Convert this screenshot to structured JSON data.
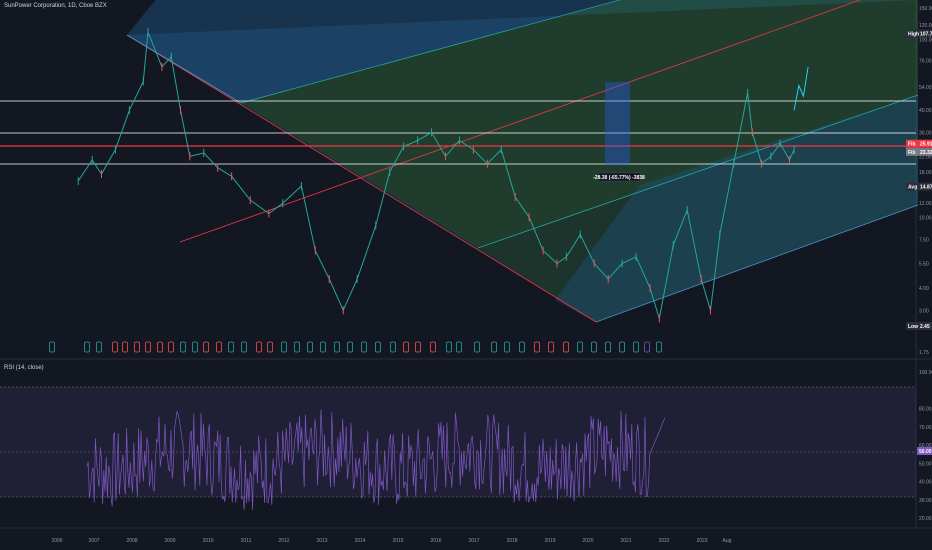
{
  "header": {
    "title": "SunPower Corporation, 1D, Cboe BZX",
    "rsi_title": "RSI (14, close)"
  },
  "colors": {
    "background": "#131722",
    "pitch_blue": "#1e5a8c",
    "pitch_green": "#2f6a3c",
    "red_line": "#f23645",
    "white_line": "#ffffff",
    "rsi_line": "#7e57c2",
    "candle_up": "#26a69a",
    "candle_down": "#ef5350"
  },
  "chart_data": [
    {
      "type": "line",
      "title": "SunPower Corporation, 1D, Cboe BZX",
      "scale": "log",
      "x_labels": [
        "2006",
        "2007",
        "2008",
        "2009",
        "2010",
        "2011",
        "2012",
        "2013",
        "2014",
        "2015",
        "2016",
        "2017",
        "2018",
        "2019",
        "2020",
        "2021",
        "2022",
        "2023",
        "Aug"
      ],
      "y_ticks": [
        "150.00",
        "120.00",
        "100.00",
        "76.00",
        "54.00",
        "40.00",
        "30.00",
        "22.00",
        "18.00",
        "12.00",
        "10.00",
        "7.50",
        "5.50",
        "4.00",
        "3.00",
        "1.75"
      ],
      "ylim": [
        1.75,
        150
      ],
      "price_tags": [
        {
          "label": "High",
          "value": "107.79"
        },
        {
          "label": "Fib",
          "value": "25.91"
        },
        {
          "label": "Fib",
          "value": "23.32"
        },
        {
          "label": "Avg",
          "value": "14.87"
        },
        {
          "label": "Low",
          "value": "2.45"
        }
      ],
      "measure_label": "-28.38 (-65.77%) -3838",
      "x": [
        2006.5,
        2006.8,
        2007.0,
        2007.3,
        2007.6,
        2007.9,
        2008.0,
        2008.3,
        2008.5,
        2008.7,
        2008.9,
        2009.2,
        2009.5,
        2009.8,
        2010.2,
        2010.6,
        2010.9,
        2011.3,
        2011.6,
        2011.9,
        2012.2,
        2012.5,
        2012.9,
        2013.2,
        2013.5,
        2013.8,
        2014.1,
        2014.4,
        2014.7,
        2015.0,
        2015.3,
        2015.6,
        2015.9,
        2016.2,
        2016.5,
        2016.8,
        2017.0,
        2017.3,
        2017.6,
        2017.9,
        2018.2,
        2018.5,
        2018.8,
        2019.0,
        2019.3,
        2019.6,
        2019.9,
        2020.1,
        2020.3,
        2020.6,
        2020.9,
        2021.0,
        2021.2,
        2021.4,
        2021.6,
        2021.8,
        2021.9
      ],
      "series": [
        {
          "values": [
            16.0,
            21.0,
            17.5,
            24.0,
            40.0,
            58.0,
            110.0,
            70.0,
            80.0,
            40.0,
            22.0,
            23.0,
            19.0,
            17.0,
            12.5,
            10.5,
            12.0,
            15.0,
            6.5,
            4.5,
            3.0,
            4.5,
            9.0,
            18.0,
            25.0,
            27.0,
            30.0,
            22.0,
            27.0,
            24.0,
            20.0,
            24.0,
            13.0,
            10.0,
            6.5,
            5.5,
            6.0,
            8.0,
            5.5,
            4.5,
            5.5,
            6.0,
            4.0,
            2.7,
            7.0,
            11.0,
            4.5,
            3.0,
            8.0,
            20.0,
            50.0,
            30.0,
            20.0,
            22.0,
            26.0,
            21.0,
            24.0
          ]
        },
        {
          "name": "Projection",
          "values_x": [
            2021.9,
            2022.0,
            2022.1,
            2022.2
          ],
          "values": [
            40.0,
            55.0,
            48.0,
            70.0
          ]
        }
      ]
    },
    {
      "type": "line",
      "title": "RSI (14, close)",
      "ylim": [
        20,
        100
      ],
      "y_ticks": [
        "100.00",
        "80.00",
        "70.00",
        "60.00",
        "50.00",
        "40.00",
        "30.00",
        "20.00"
      ],
      "bands": [
        70,
        30
      ],
      "current_value": "50.00"
    }
  ]
}
